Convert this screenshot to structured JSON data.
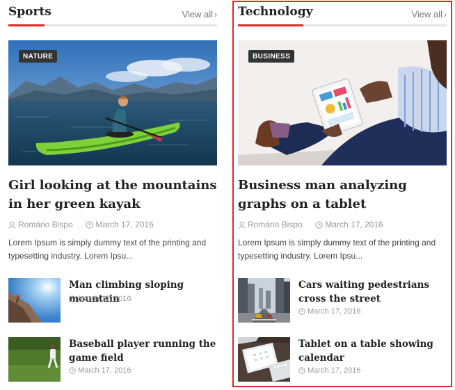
{
  "sections": [
    {
      "title": "Sports",
      "view_all": "View all",
      "featured": {
        "category": "NATURE",
        "title": "Girl looking at the mountains in her green kayak",
        "author": "Romário Bispo",
        "date": "March 17, 2016",
        "excerpt": "Lorem Ipsum is simply dummy text of the printing and typesetting industry. Lorem Ipsu..."
      },
      "items": [
        {
          "title": "Man climbing sloping mountain",
          "date": "March 17, 2016"
        },
        {
          "title": "Baseball player running the game field",
          "date": "March 17, 2016"
        }
      ]
    },
    {
      "title": "Technology",
      "view_all": "View all",
      "featured": {
        "category": "BUSINESS",
        "title": "Business man analyzing graphs on a tablet",
        "author": "Romário Bispo",
        "date": "March 17, 2016",
        "excerpt": "Lorem Ipsum is simply dummy text of the printing and typesetting industry. Lorem Ipsu..."
      },
      "items": [
        {
          "title": "Cars waiting pedestrians cross the street",
          "date": "March 17, 2016"
        },
        {
          "title": "Tablet on a table showing calendar",
          "date": "March 17, 2016"
        }
      ]
    }
  ],
  "colors": {
    "accent": "#e32525",
    "badge_bg": "#333333",
    "meta_text": "#999999"
  },
  "icons": {
    "author": "user-icon",
    "date": "clock-icon",
    "view_all": "chevron-right-icon"
  }
}
